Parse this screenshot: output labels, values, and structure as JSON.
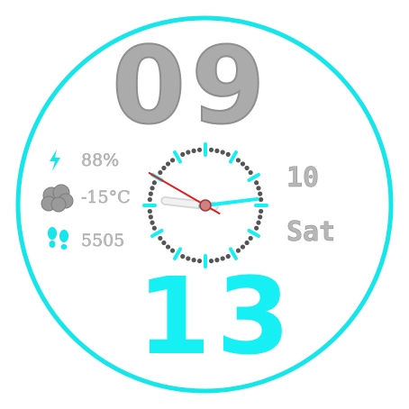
{
  "watchface": {
    "hour": "09",
    "minute": "13",
    "date_day": "10",
    "weekday": "Sat",
    "battery": "88%",
    "temperature": "-15°C",
    "steps": "5505"
  },
  "icons": {
    "battery": "lightning-bolt-icon",
    "weather": "cloud-icon",
    "steps": "footprints-icon"
  },
  "analog_clock": {
    "hour": 9,
    "minute": 13,
    "second": 50
  },
  "colors": {
    "accent": "#16f0f4",
    "hour_digits": "#ababab",
    "second_hand": "#e02020",
    "ring": "#16e5ea",
    "dots": "#555555"
  }
}
